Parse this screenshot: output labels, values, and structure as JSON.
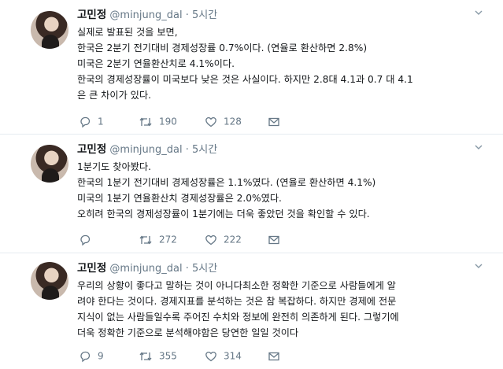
{
  "tweets": [
    {
      "name": "고민정",
      "handle": "@minjung_dal",
      "dot": "·",
      "time": "5시간",
      "lines": [
        "실제로 발표된 것을 보면,",
        "한국은 2분기 전기대비 경제성장률 0.7%이다. (연율로 환산하면 2.8%)",
        "미국은 2분기 연율환산치로 4.1%이다.",
        "한국의 경제성장률이 미국보다 낮은 것은 사실이다. 하지만 2.8대 4.1과 0.7 대 4.1",
        "은 큰 차이가 있다."
      ],
      "replies": "1",
      "retweets": "190",
      "likes": "128"
    },
    {
      "name": "고민정",
      "handle": "@minjung_dal",
      "dot": "·",
      "time": "5시간",
      "lines": [
        "1분기도 찾아봤다.",
        "한국의 1분기 전기대비 경제성장률은 1.1%였다. (연율로 환산하면 4.1%)",
        "미국의 1분기 연율환산치 경제성장률은 2.0%였다.",
        "오히려 한국의 경제성장률이 1분기에는 더욱 좋았던 것을 확인할 수 있다."
      ],
      "replies": "",
      "retweets": "272",
      "likes": "222"
    },
    {
      "name": "고민정",
      "handle": "@minjung_dal",
      "dot": "·",
      "time": "5시간",
      "lines": [
        "우리의 상황이 좋다고 말하는 것이 아니다최소한 정확한 기준으로 사람들에게 알",
        "려야 한다는 것이다. 경제지표를 분석하는 것은 참 복잡하다. 하지만 경제에 전문",
        "지식이 없는 사람들일수록 주어진 수치와 정보에 완전히 의존하게 된다. 그렇기에",
        "더욱 정확한 기준으로 분석해야함은 당연한 일일 것이다"
      ],
      "replies": "9",
      "retweets": "355",
      "likes": "314"
    }
  ],
  "icons": {
    "reply": "reply-icon",
    "retweet": "retweet-icon",
    "like": "heart-icon",
    "dm": "mail-icon",
    "menu": "chevron-down-icon"
  },
  "colors": {
    "text": "#14171a",
    "muted": "#657786",
    "divider": "#e6ecf0"
  }
}
